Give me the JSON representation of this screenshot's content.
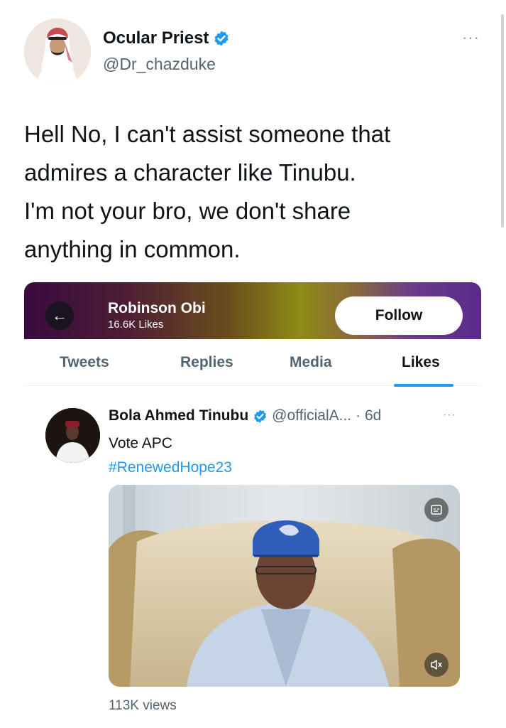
{
  "tweet": {
    "author_name": "Ocular Priest",
    "author_handle": "@Dr_chazduke",
    "more_label": "···",
    "lines": [
      "Hell No, I can't assist someone that",
      "admires a character like Tinubu.",
      "I'm not your bro, we don't share",
      "anything in common."
    ]
  },
  "embedded": {
    "back_label": "←",
    "profile_name": "Robinson Obi",
    "profile_likes": "16.6K Likes",
    "follow_label": "Follow",
    "tabs": [
      {
        "label": "Tweets",
        "active": false
      },
      {
        "label": "Replies",
        "active": false
      },
      {
        "label": "Media",
        "active": false
      },
      {
        "label": "Likes",
        "active": true
      }
    ],
    "liked_tweet": {
      "name": "Bola Ahmed Tinubu",
      "handle": "@officialA...",
      "time": "· 6d",
      "more_label": "···",
      "text": "Vote APC",
      "hashtag": "#RenewedHope23",
      "views": "113K views"
    }
  },
  "colors": {
    "accent": "#1d9bf0",
    "text_primary": "#0f1419",
    "text_secondary": "#536471"
  },
  "icons": [
    "verified-badge-icon",
    "more-icon",
    "back-arrow-icon",
    "captions-icon",
    "mute-icon"
  ]
}
